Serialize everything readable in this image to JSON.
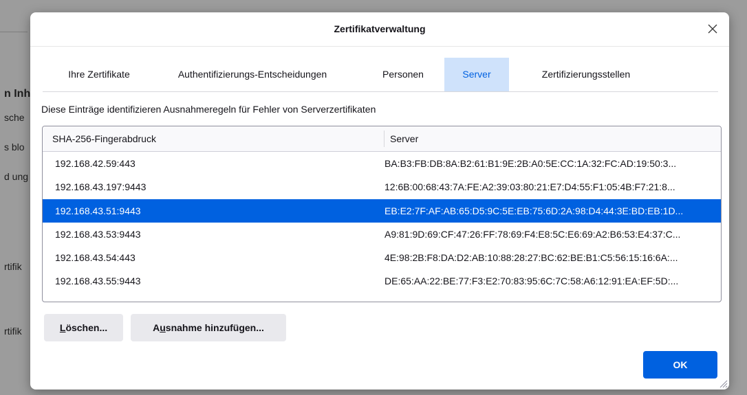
{
  "background": {
    "items": [
      {
        "text": "n Inh"
      },
      {
        "text": "sche"
      },
      {
        "text": "s blo"
      },
      {
        "text": "d ung"
      },
      {
        "text": "rtifik"
      },
      {
        "text": "rtifik"
      }
    ]
  },
  "dialog": {
    "title": "Zertifikatverwaltung",
    "close_icon": "close-icon",
    "tabs": [
      {
        "label": "Ihre Zertifikate",
        "selected": false
      },
      {
        "label": "Authentifizierungs-Entscheidungen",
        "selected": false
      },
      {
        "label": "Personen",
        "selected": false
      },
      {
        "label": "Server",
        "selected": true
      },
      {
        "label": "Zertifizierungsstellen",
        "selected": false
      }
    ],
    "description": "Diese Einträge identifizieren Ausnahmeregeln für Fehler von Serverzertifikaten",
    "table": {
      "columns": [
        "SHA-256-Fingerabdruck",
        "Server"
      ],
      "rows": [
        {
          "host": "192.168.42.59:443",
          "fingerprint": "BA:B3:FB:DB:8A:B2:61:B1:9E:2B:A0:5E:CC:1A:32:FC:AD:19:50:3...",
          "selected": false
        },
        {
          "host": "192.168.43.197:9443",
          "fingerprint": "12:6B:00:68:43:7A:FE:A2:39:03:80:21:E7:D4:55:F1:05:4B:F7:21:8...",
          "selected": false
        },
        {
          "host": "192.168.43.51:9443",
          "fingerprint": "EB:E2:7F:AF:AB:65:D5:9C:5E:EB:75:6D:2A:98:D4:44:3E:BD:EB:1D...",
          "selected": true
        },
        {
          "host": "192.168.43.53:9443",
          "fingerprint": "A9:81:9D:69:CF:47:26:FF:78:69:F4:E8:5C:E6:69:A2:B6:53:E4:37:C...",
          "selected": false
        },
        {
          "host": "192.168.43.54:443",
          "fingerprint": "4E:98:2B:F8:DA:D2:AB:10:88:28:27:BC:62:BE:B1:C5:56:15:16:6A:...",
          "selected": false
        },
        {
          "host": "192.168.43.55:9443",
          "fingerprint": "DE:65:AA:22:BE:77:F3:E2:70:83:95:6C:7C:58:A6:12:91:EA:EF:5D:...",
          "selected": false
        }
      ]
    },
    "buttons": {
      "delete_pre": "",
      "delete_mnemonic": "L",
      "delete_post": "öschen...",
      "add_pre": "A",
      "add_mnemonic": "u",
      "add_post": "snahme hinzufügen...",
      "ok": "OK"
    },
    "colors": {
      "accent": "#0061e0",
      "selected_tab_bg": "#cfe2fb"
    }
  }
}
